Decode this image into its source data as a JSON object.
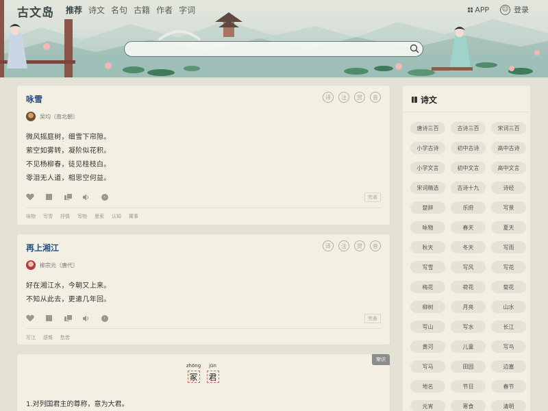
{
  "header": {
    "logo": "古文岛",
    "nav": [
      "推荐",
      "诗文",
      "名句",
      "古籍",
      "作者",
      "字词"
    ],
    "app_label": "APP",
    "login_label": "登录",
    "search": {
      "value": "",
      "placeholder": ""
    }
  },
  "poems": [
    {
      "title": "咏雪",
      "author": "吴均〔南北朝〕",
      "lines": [
        "微风摇庭树，细雪下帘隙。",
        "萦空如雾转，凝阶似花积。",
        "不见杨柳春，徒见桂枝白。",
        "零泪无人道，相思空何益。"
      ],
      "tools": [
        "译",
        "注",
        "赏",
        "音"
      ],
      "perfect_label": "完善",
      "tags": [
        "咏物",
        "写雪",
        "抒情",
        "写物",
        "思索",
        "认知",
        "寓事"
      ]
    },
    {
      "title": "再上湘江",
      "author": "柳宗元〔唐代〕",
      "lines": [
        "好在湘江水，今朝又上来。",
        "不知从此去，更遣几年回。"
      ],
      "tools": [
        "译",
        "注",
        "赏",
        "音"
      ],
      "perfect_label": "完善",
      "tags": [
        "写江",
        "感慨",
        "愁苦"
      ]
    }
  ],
  "knowledge": {
    "badge": "常识",
    "chars": [
      {
        "pinyin": "zhōng",
        "char": "冢"
      },
      {
        "pinyin": "jūn",
        "char": "君"
      }
    ],
    "text": "1.对列国君主的尊称，意为大君。"
  },
  "sidebar": {
    "title": "诗文",
    "items": [
      "唐诗三百",
      "古诗三百",
      "宋词三百",
      "小学古诗",
      "初中古诗",
      "高中古诗",
      "小学文言",
      "初中文言",
      "高中文言",
      "宋词精选",
      "古诗十九",
      "诗经",
      "楚辞",
      "乐府",
      "写景",
      "咏物",
      "春天",
      "夏天",
      "秋天",
      "冬天",
      "写雨",
      "写雪",
      "写风",
      "写花",
      "梅花",
      "荷花",
      "菊花",
      "柳树",
      "月亮",
      "山水",
      "写山",
      "写水",
      "长江",
      "黄河",
      "儿童",
      "写鸟",
      "写马",
      "田园",
      "边塞",
      "地名",
      "节日",
      "春节",
      "元宵",
      "寒食",
      "清明"
    ]
  },
  "colors": {
    "page_bg": "#e4e2d4",
    "card_bg": "#f3f0e3",
    "title_blue": "#1e4f86",
    "pill_bg": "#e6e3d6",
    "badge_gray": "#8b8d8a"
  }
}
